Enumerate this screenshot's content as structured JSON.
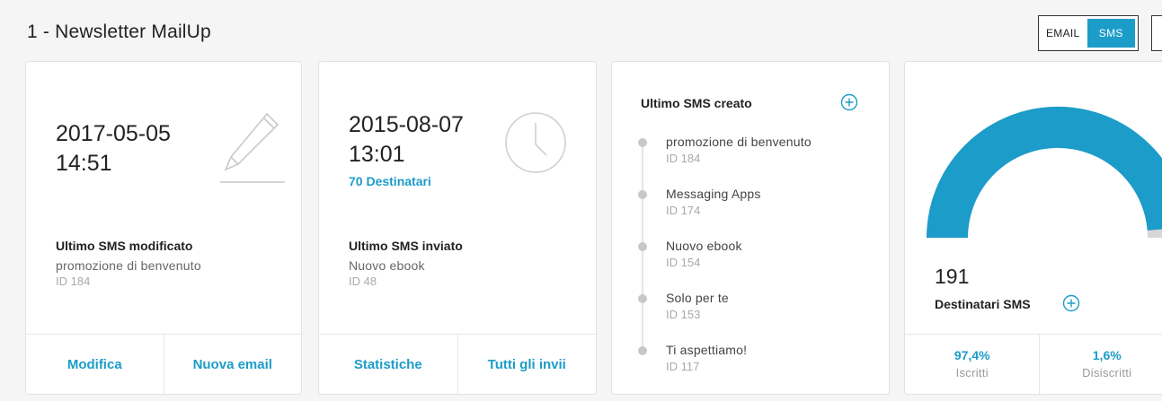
{
  "page": {
    "title": "1 - Newsletter MailUp"
  },
  "channel_toggle": {
    "email_label": "EMAIL",
    "sms_label": "SMS",
    "active": "SMS",
    "active_color": "#1c9cc9"
  },
  "last_modified": {
    "date": "2017-05-05",
    "time": "14:51",
    "icon": "pencil-icon",
    "title": "Ultimo SMS modificato",
    "name": "promozione di benvenuto",
    "id": "ID 184",
    "actions": [
      "Modifica",
      "Nuova email"
    ]
  },
  "last_sent": {
    "date": "2015-08-07",
    "time": "13:01",
    "recipients": "70 Destinatari",
    "icon": "clock-icon",
    "title": "Ultimo SMS inviato",
    "name": "Nuovo ebook",
    "id": "ID 48",
    "actions": [
      "Statistiche",
      "Tutti gli invii"
    ]
  },
  "last_created": {
    "title": "Ultimo SMS creato",
    "add_icon": "plus-circle-icon",
    "items": [
      {
        "name": "promozione di benvenuto",
        "id": "ID 184"
      },
      {
        "name": "Messaging Apps",
        "id": "ID 174"
      },
      {
        "name": "Nuovo ebook",
        "id": "ID 154"
      },
      {
        "name": "Solo per te",
        "id": "ID 153"
      },
      {
        "name": "Ti aspettiamo!",
        "id": "ID 117"
      }
    ]
  },
  "recipients": {
    "count": "191",
    "label": "Destinatari SMS",
    "add_icon": "plus-circle-icon",
    "subscribed_fraction": 0.974,
    "subscribed_color": "#1c9cc9",
    "unsubscribed_color": "#d6d6d6",
    "stats": [
      {
        "value": "97,4%",
        "label": "Iscritti"
      },
      {
        "value": "1,6%",
        "label": "Disiscritti"
      }
    ]
  }
}
